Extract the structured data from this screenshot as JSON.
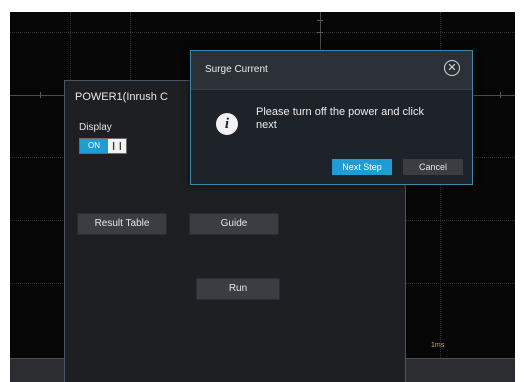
{
  "panel": {
    "title": "POWER1(Inrush C",
    "display_label": "Display",
    "toggle_on": "ON",
    "toggle_off": "",
    "result_table_button": "Result Table",
    "guide_button": "Guide",
    "run_button": "Run"
  },
  "dialog": {
    "title": "Surge Current",
    "close_icon": "close-circle-icon",
    "info_icon": "info-icon",
    "message": "Please turn off the power and click next",
    "next_button": "Next Step",
    "cancel_button": "Cancel"
  },
  "status": {
    "time_label": "1ms"
  },
  "colors": {
    "accent": "#1f9bd6",
    "dialog_border": "#3f87aa",
    "time_label": "#d4a820"
  }
}
